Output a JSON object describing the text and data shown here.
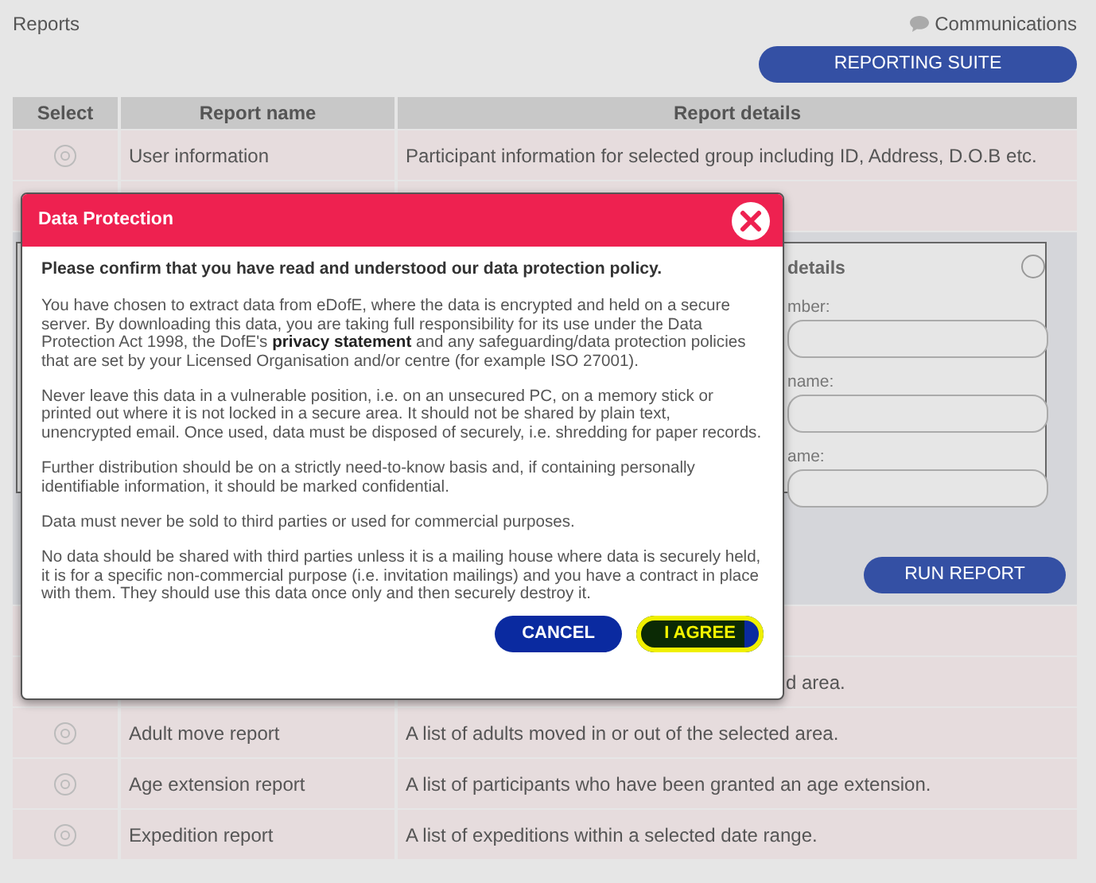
{
  "page": {
    "title": "Reports",
    "communications": "Communications",
    "reporting_button": "REPORTING SUITE"
  },
  "table": {
    "columns": [
      "Select",
      "Report name",
      "Report details"
    ],
    "rows": [
      {
        "kind": "report",
        "selected": false,
        "name": "User information",
        "details": "Participant information for selected group including ID, Address, D.O.B etc."
      },
      {
        "kind": "covered"
      },
      {
        "kind": "panel",
        "box": {
          "title": "details",
          "selected": false,
          "fields": [
            {
              "label": "mber:"
            },
            {
              "label": "name:"
            },
            {
              "label": "ame:"
            }
          ]
        },
        "button": "RUN REPORT"
      },
      {
        "kind": "covered"
      },
      {
        "kind": "report",
        "details": "d area."
      },
      {
        "kind": "report",
        "selected": false,
        "name": "Adult move report",
        "details": "A list of adults moved in or out of the selected area."
      },
      {
        "kind": "report",
        "selected": false,
        "name": "Age extension report",
        "details": "A list of participants who have been granted an age extension."
      },
      {
        "kind": "report",
        "selected": false,
        "name": "Expedition report",
        "details": "A list of expeditions within a selected date range."
      }
    ]
  },
  "modal": {
    "title": "Data Protection",
    "lead": "Please confirm that you have read and understood our data protection policy.",
    "paragraphs": [
      "You have chosen to extract data from eDofE, where the data is encrypted and held on a secure server. By downloading this data, you are taking full responsibility for its use under the Data Protection Act 1998, the DofE's **privacy statement** and any safeguarding/data protection policies that are set by your Licensed Organisation and/or centre (for example ISO 27001).",
      "Never leave this data in a vulnerable position, i.e. on an unsecured PC, on a memory stick or printed out where it is not locked in a secure area.  It should not be shared by plain text, unencrypted email.  Once used, data must be disposed of securely, i.e. shredding for paper records.",
      "Further distribution should be on a strictly need-to-know basis and, if containing personally identifiable information, it should be marked confidential.",
      "Data must never be sold to third parties or used for commercial purposes.",
      "No data should be shared with third parties unless it is a mailing house where data is securely held, it is for a specific non-commercial purpose (i.e. invitation mailings) and you have a contract in place with them. They should use this data once only and then securely destroy it."
    ],
    "buttons": [
      {
        "label": "CANCEL",
        "kind": "cancel"
      },
      {
        "label": "I AGREE",
        "kind": "agree"
      }
    ]
  }
}
